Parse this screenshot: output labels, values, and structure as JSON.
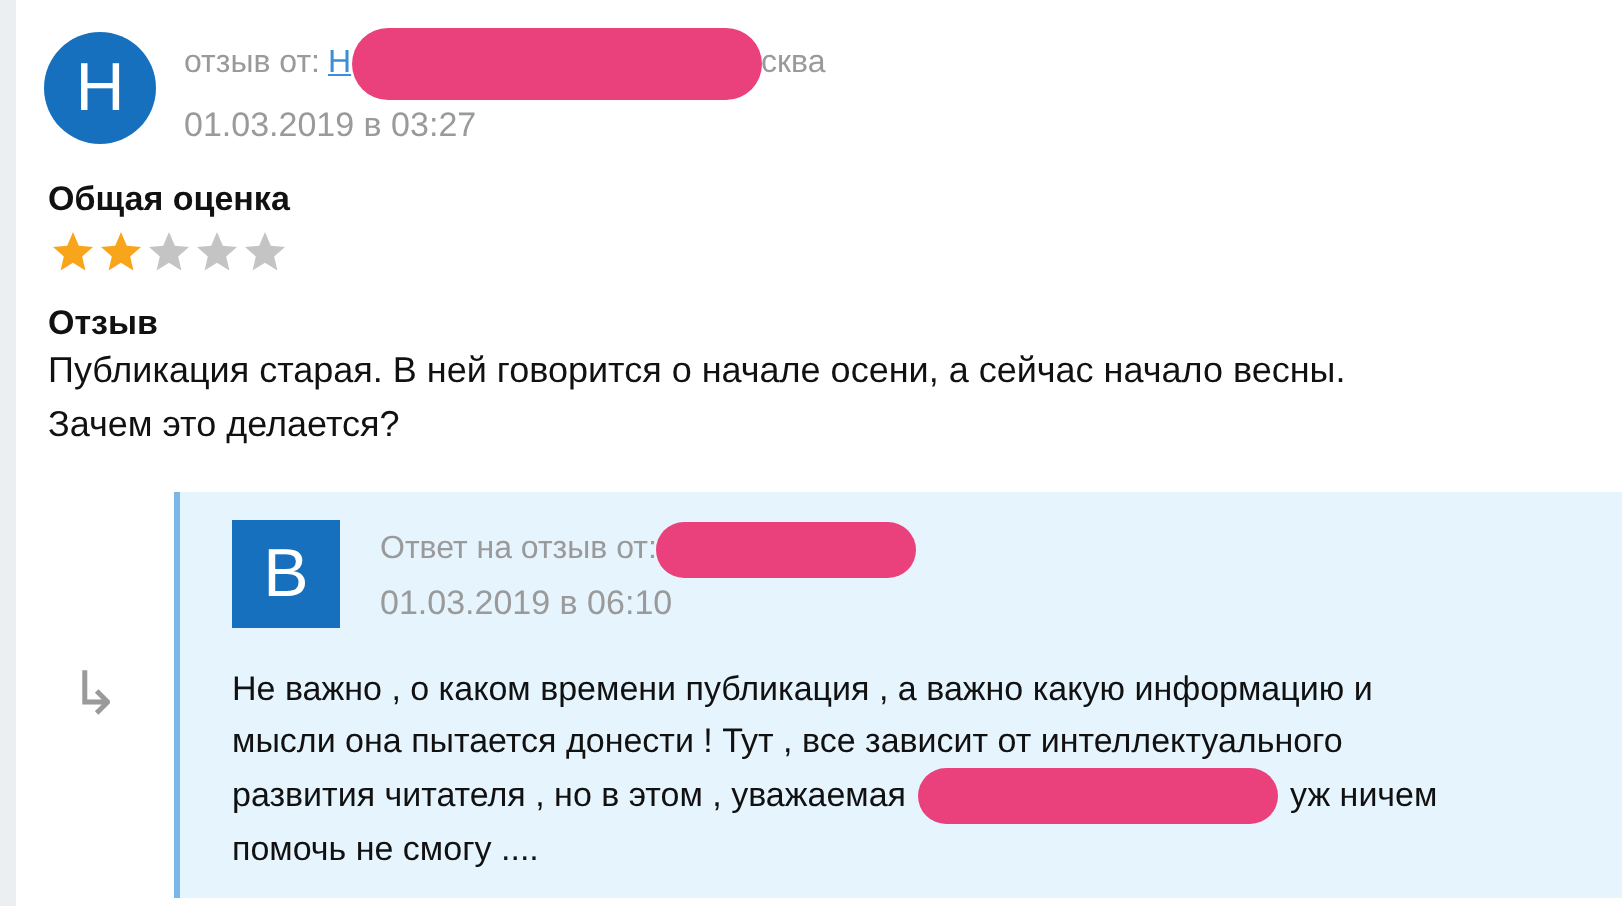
{
  "review": {
    "avatar_letter": "Н",
    "label": "отзыв от:",
    "author_link": "Н",
    "author_redacted": true,
    "author_tail": "сква",
    "date": "01.03.2019 в 03:27"
  },
  "rating": {
    "heading": "Общая оценка",
    "stars": 2
  },
  "comment": {
    "heading": "Отзыв",
    "text": "Публикация старая. В ней говорится о начале осени, а сейчас начало весны. Зачем это делается?"
  },
  "reply": {
    "arrow": "↳",
    "avatar_letter": "В",
    "label": "Ответ на отзыв от:",
    "author_redacted": true,
    "date": "01.03.2019 в 06:10",
    "text_lines": [
      {
        "segments": [
          {
            "text": "Не важно , о каком времени публикация , а важно какую информацию и"
          }
        ]
      },
      {
        "segments": [
          {
            "text": "мысли она пытается донести ! Тут , все зависит от интеллектуального"
          }
        ]
      },
      {
        "segments": [
          {
            "text": "развития читателя , но в этом , уважаемая",
            "redacted_after": true
          },
          {
            "text": "уж ничем"
          }
        ]
      },
      {
        "segments": [
          {
            "text": "помочь не смогу ...."
          }
        ]
      }
    ]
  }
}
